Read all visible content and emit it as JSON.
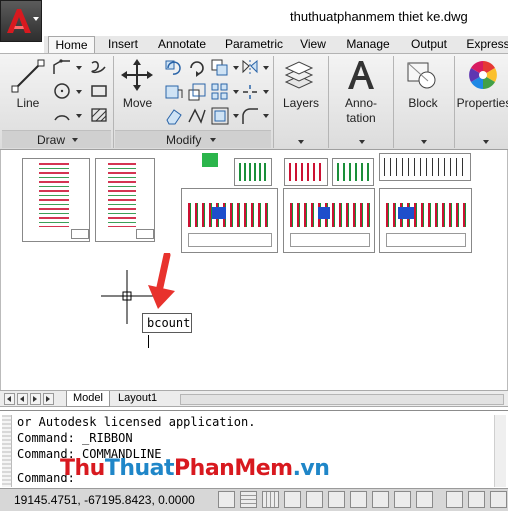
{
  "app": {
    "document_title": "thuthuatphanmem thiet ke.dwg"
  },
  "ribbon": {
    "tabs": [
      "Home",
      "Insert",
      "Annotate",
      "Parametric",
      "View",
      "Manage",
      "Output",
      "Express"
    ],
    "active_tab": "Home",
    "panels": {
      "draw": {
        "label": "Draw",
        "line_label": "Line"
      },
      "modify": {
        "label": "Modify",
        "move_label": "Move"
      },
      "layers": {
        "label": "Layers"
      },
      "annotation": {
        "label_line1": "Anno-",
        "label_line2": "tation"
      },
      "block": {
        "label": "Block"
      },
      "properties": {
        "label": "Properties"
      }
    }
  },
  "canvas": {
    "command_input_value": "bcount"
  },
  "layout_tabs": {
    "tabs": [
      "Model",
      "Layout1"
    ],
    "active": "Model"
  },
  "command_window": {
    "lines": [
      "or Autodesk licensed application.",
      "Command: _RIBBON",
      "Command: COMMANDLINE",
      "Command:"
    ]
  },
  "watermark": {
    "part1": "Thu",
    "part2": "Thuat",
    "part3": "PhanMem",
    "part4": ".vn"
  },
  "status_bar": {
    "coordinates": "19145.4751, -67195.8423, 0.0000"
  },
  "colors": {
    "app_button_red": "#d8191f",
    "watermark_red": "#d8191f",
    "watermark_blue": "#1f86c8",
    "arrow_red": "#e8322d"
  }
}
